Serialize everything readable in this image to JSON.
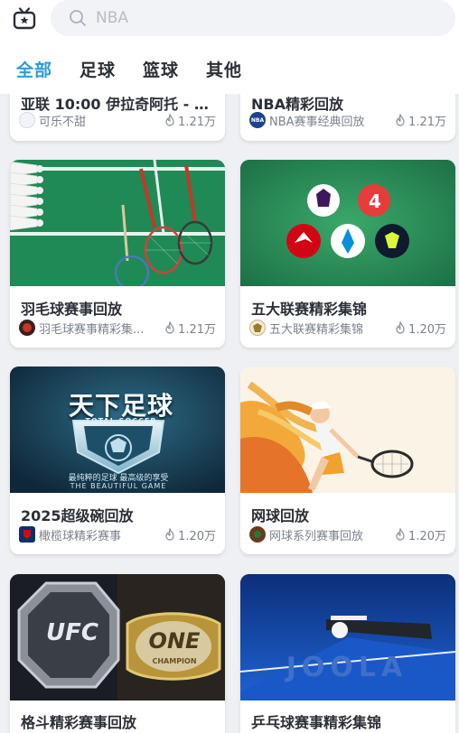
{
  "search": {
    "placeholder": "NBA"
  },
  "tabs": [
    {
      "label": "全部",
      "active": true
    },
    {
      "label": "足球"
    },
    {
      "label": "篮球"
    },
    {
      "label": "其他"
    }
  ],
  "cards": [
    {
      "title": "亚联 10:00 伊拉奇阿托 - 阿...",
      "source": "可乐不甜",
      "views": "1.21万"
    },
    {
      "title": "NBA精彩回放",
      "source": "NBA赛事经典回放",
      "views": "1.21万"
    },
    {
      "title": "羽毛球赛事回放",
      "source": "羽毛球赛事精彩集...",
      "views": "1.21万"
    },
    {
      "title": "五大联赛精彩集锦",
      "source": "五大联赛精彩集锦",
      "views": "1.20万"
    },
    {
      "title": "2025超级碗回放",
      "source": "橄榄球精彩赛事",
      "views": "1.20万"
    },
    {
      "title": "网球回放",
      "source": "网球系列赛事回放",
      "views": "1.20万"
    },
    {
      "title": "格斗精彩赛事回放",
      "source": "",
      "views": ""
    },
    {
      "title": "乒乓球赛事精彩集锦",
      "source": "",
      "views": ""
    }
  ],
  "thumb_text": {
    "football_cn": "天下足球",
    "football_en": "TOTAL SOCCER",
    "football_tag_cn": "最纯粹的足球 最高级的享受",
    "football_tag_en": "THE BEAUTIFUL GAME",
    "ufc": "UFC",
    "one": "ONE",
    "champion": "CHAMPION",
    "joola": "JOOLA",
    "nba_avatar": "NBA"
  },
  "colors": {
    "accent": "#2b9bd8",
    "badminton_court": "#1f8a55",
    "football_bg": "#1a3f56",
    "table_tennis": "#1450b8"
  }
}
